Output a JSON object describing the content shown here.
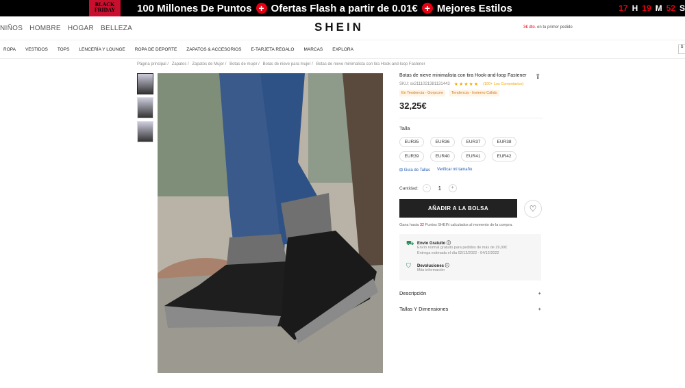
{
  "promo": {
    "logo": "BLACK FRIDAY",
    "items": [
      "100 Millones De Puntos",
      "Ofertas Flash a partir de 0.01€",
      "Mejores Estilos"
    ],
    "countdown": [
      {
        "value": "17",
        "unit": "H"
      },
      {
        "value": "19",
        "unit": "M"
      },
      {
        "value": "52",
        "unit": "S"
      }
    ]
  },
  "header": {
    "nav": [
      "NIÑOS",
      "HOMBRE",
      "HOGAR",
      "BELLEZA"
    ],
    "logo": "SHEIN",
    "promo_amount": "3€ dto.",
    "promo_text": "en tu primer pedido"
  },
  "categories": [
    "ROPA",
    "VESTIDOS",
    "TOPS",
    "LENCERÍA Y LOUNGE",
    "ROPA DE DEPORTE",
    "ZAPATOS & ACCESORIOS",
    "E-TARJETA REGALO",
    "MARCAS",
    "EXPLORA"
  ],
  "breadcrumb": [
    "Página principal /",
    "Zapatos /",
    "Zapatos de Mujer /",
    "Botas de mujer /",
    "Botas de nieve para mujer /",
    "Botas de nieve minimalista con tira Hook-and-loop Fastener"
  ],
  "product": {
    "title": "Botas de nieve minimalista con tira Hook-and-loop Fastener",
    "sku": "SKU: sx2111021381131443",
    "stars": "★★★★★",
    "reviews": "(100+ Los Comentarios)",
    "tags": [
      "En Tendencia - Gorpcore",
      "Tendencia - Invierno Cálido"
    ],
    "price": "32,25€",
    "size_label": "Talla",
    "sizes": [
      "EUR35",
      "EUR36",
      "EUR37",
      "EUR38",
      "EUR39",
      "EUR40",
      "EUR41",
      "EUR42"
    ],
    "size_guide": "Guía de Tallas",
    "verify_size": "Verificar mi tamaño",
    "qty_label": "Cantidad:",
    "qty": "1",
    "add_to_bag": "AÑADIR A LA BOLSA",
    "points_pre": "Gana hasta",
    "points_num": "32",
    "points_post": "Puntos SHEIN calculados al momento de la compra."
  },
  "shipping": {
    "free_title": "Envío Gratuito",
    "free_line1": "Envío normal gratuito para pedidos de más de 29,00€",
    "free_line2": "Entrega estimada el día 02/12/2022 - 04/12/2022",
    "returns_title": "Devoluciones",
    "returns_line": "Más información"
  },
  "sections": [
    {
      "label": "Descripción",
      "icon": "+"
    },
    {
      "label": "Tallas Y Dimensiones",
      "icon": "+"
    }
  ],
  "colors": {
    "accent": "#e60012",
    "star": "#f6a800",
    "link": "#1e5ab4"
  }
}
